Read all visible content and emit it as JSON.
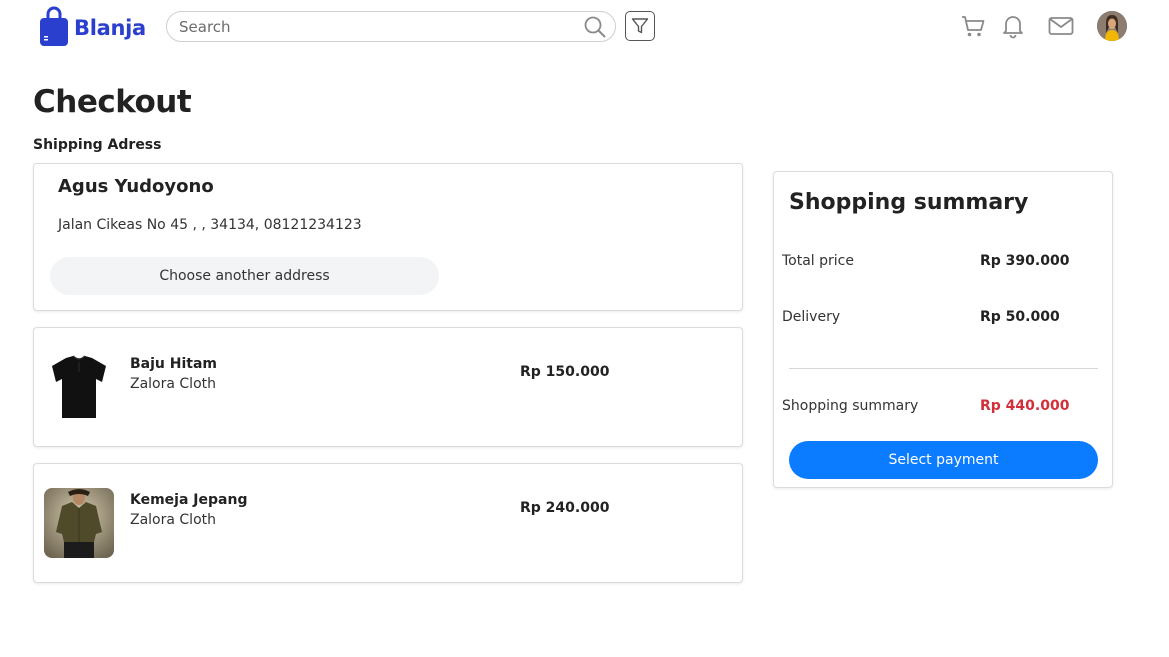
{
  "header": {
    "brand": "Blanja",
    "brand_color": "#2b3fcf",
    "search_placeholder": "Search",
    "icons": [
      "search-icon",
      "filter-icon",
      "cart-icon",
      "bell-icon",
      "mail-icon"
    ]
  },
  "page": {
    "title": "Checkout",
    "shipping_label": "Shipping Adress"
  },
  "address": {
    "name": "Agus Yudoyono",
    "detail": "Jalan Cikeas No 45 , , 34134, 08121234123",
    "change_button": "Choose another address"
  },
  "items": [
    {
      "name": "Baju Hitam",
      "store": "Zalora Cloth",
      "price": "Rp 150.000",
      "image": "black-tshirt"
    },
    {
      "name": "Kemeja Jepang",
      "store": "Zalora Cloth",
      "price": "Rp 240.000",
      "image": "olive-shirt"
    }
  ],
  "summary": {
    "title": "Shopping summary",
    "rows": [
      {
        "label": "Total price",
        "value": "Rp 390.000"
      },
      {
        "label": "Delivery",
        "value": "Rp 50.000"
      }
    ],
    "total_label": "Shopping summary",
    "total_value": "Rp 440.000",
    "total_color": "#d32f3a",
    "pay_button": "Select payment",
    "pay_button_color": "#0b7bff"
  }
}
